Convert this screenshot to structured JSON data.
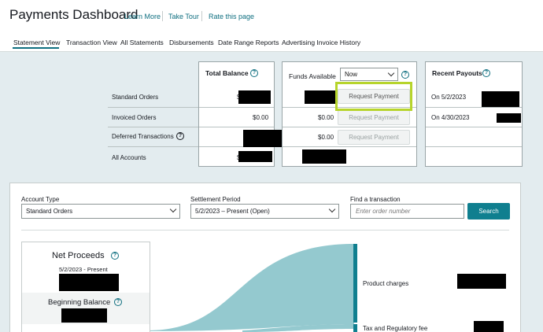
{
  "header": {
    "title": "Payments Dashboard",
    "links": [
      "Learn More",
      "Take Tour",
      "Rate this page"
    ]
  },
  "tabs": [
    "Statement View",
    "Transaction View",
    "All Statements",
    "Disbursements",
    "Date Range Reports",
    "Advertising Invoice History"
  ],
  "summary": {
    "row_labels": [
      "Standard Orders",
      "Invoiced Orders",
      "Deferred Transactions",
      "All Accounts"
    ],
    "total_balance": {
      "title": "Total Balance",
      "invoiced": "$0.00",
      "prefix": "$"
    },
    "funds_available": {
      "title": "Funds Available",
      "select_value": "Now",
      "invoiced": "$0.00",
      "deferred": "$0.00",
      "button_label": "Request Payment"
    },
    "recent_payouts": {
      "title": "Recent Payouts",
      "dates": [
        "On 5/2/2023",
        "On 4/30/2023"
      ]
    }
  },
  "filters": {
    "account_type": {
      "label": "Account Type",
      "value": "Standard Orders"
    },
    "settlement_period": {
      "label": "Settlement Period",
      "value": "5/2/2023 – Present (Open)"
    },
    "find": {
      "label": "Find a transaction",
      "placeholder": "Enter order number",
      "button": "Search"
    }
  },
  "net_proceeds": {
    "title": "Net Proceeds",
    "period": "5/2/2023 - Present",
    "beginning_balance": "Beginning Balance"
  },
  "sankey": {
    "labels": [
      "Product charges",
      "Tax and Regulatory fee"
    ],
    "color": "#94c9cf"
  },
  "colors": {
    "accent": "#0f7f8f",
    "highlight": "#b6d42b"
  }
}
